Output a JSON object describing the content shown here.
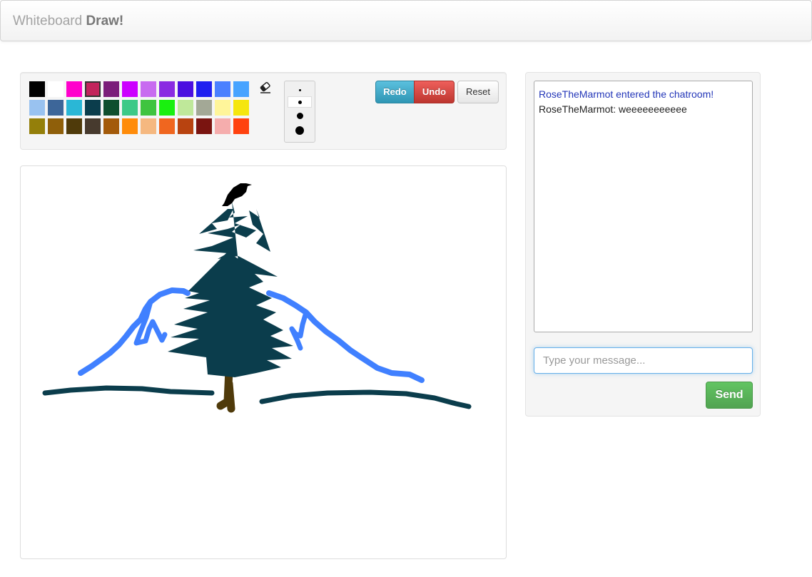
{
  "brand": {
    "light": "Whiteboard",
    "bold": "Draw!"
  },
  "toolbar": {
    "colors": [
      "#000000",
      "#ffffff",
      "#ff00cc",
      "#c2255c",
      "#7b1e7a",
      "#cc00ff",
      "#c86bf0",
      "#8a2be2",
      "#4b0fe0",
      "#1f1ff0",
      "#4a80ff",
      "#47a3ff",
      "#99c2f0",
      "#3d6699",
      "#2ab7d6",
      "#0b3d4c",
      "#0f4f2e",
      "#3cc987",
      "#3fc43f",
      "#19f00f",
      "#bfe89a",
      "#a3a896",
      "#fff59a",
      "#f5e60f",
      "#947f0a",
      "#8f5f0a",
      "#4f3a0a",
      "#473a2e",
      "#a35a0a",
      "#ff8c0a",
      "#f5b880",
      "#f0661f",
      "#b84310",
      "#7a1410",
      "#f5adad",
      "#ff420f"
    ],
    "selected_color_index": 3,
    "eraser_icon": "eraser-icon",
    "brush_sizes": [
      {
        "name": "brush-size-1",
        "diameter": 3
      },
      {
        "name": "brush-size-2",
        "diameter": 5
      },
      {
        "name": "brush-size-3",
        "diameter": 9
      },
      {
        "name": "brush-size-4",
        "diameter": 12
      }
    ],
    "selected_size_index": 1,
    "redo_label": "Redo",
    "undo_label": "Undo",
    "reset_label": "Reset"
  },
  "chat": {
    "messages": [
      {
        "type": "system",
        "text": "RoseTheMarmot entered the chatroom!"
      },
      {
        "type": "user",
        "text": "RoseTheMarmot: weeeeeeeeeee"
      }
    ],
    "input_placeholder": "Type your message...",
    "send_label": "Send"
  },
  "drawing_colors": {
    "mountain": "#4080ff",
    "tree": "#0b3d4c",
    "ground": "#0b3d4c",
    "trunk": "#4f3a0a",
    "bird": "#000000"
  }
}
